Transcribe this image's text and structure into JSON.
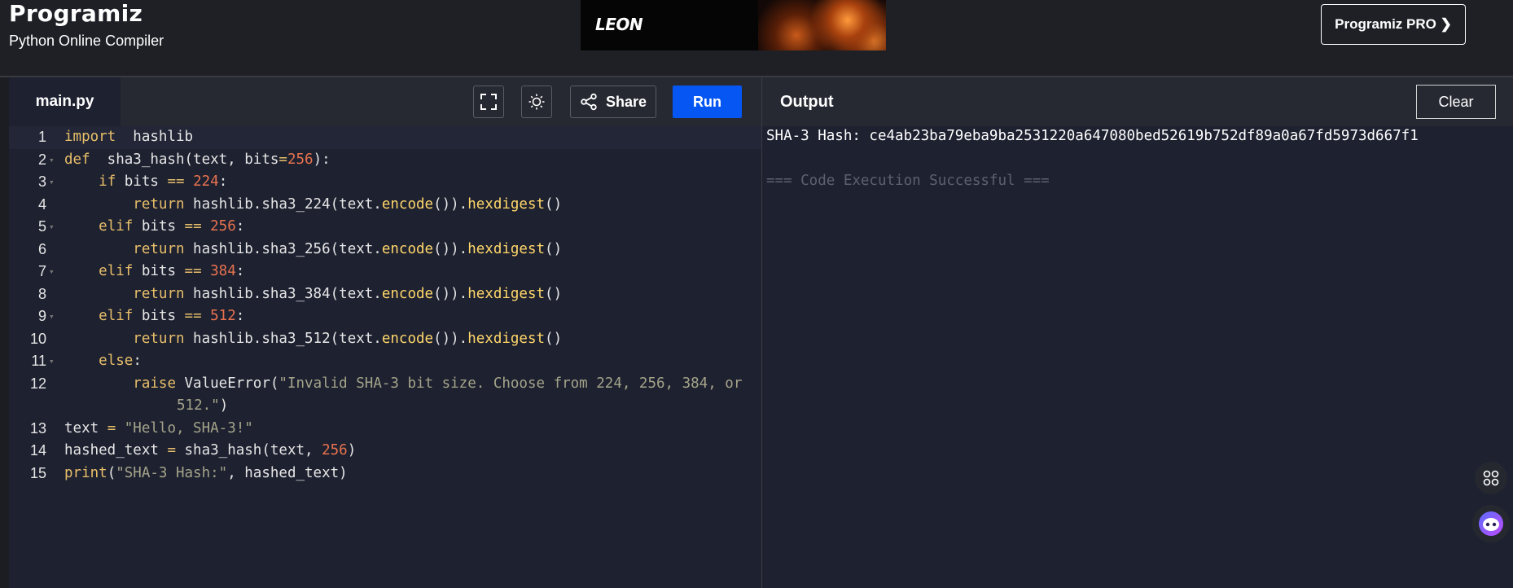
{
  "header": {
    "brand": "Programiz",
    "subtitle": "Python Online Compiler",
    "ad_text": "LEON",
    "pro_button": "Programiz PRO ❯"
  },
  "editor": {
    "file_tab": "main.py",
    "share_label": "Share",
    "run_label": "Run",
    "lines": [
      {
        "n": "1",
        "fold": false
      },
      {
        "n": "2",
        "fold": true
      },
      {
        "n": "3",
        "fold": true
      },
      {
        "n": "4",
        "fold": false
      },
      {
        "n": "5",
        "fold": true
      },
      {
        "n": "6",
        "fold": false
      },
      {
        "n": "7",
        "fold": true
      },
      {
        "n": "8",
        "fold": false
      },
      {
        "n": "9",
        "fold": true
      },
      {
        "n": "10",
        "fold": false
      },
      {
        "n": "11",
        "fold": true
      },
      {
        "n": "12",
        "fold": false
      },
      {
        "n": "13",
        "fold": false
      },
      {
        "n": "14",
        "fold": false
      },
      {
        "n": "15",
        "fold": false
      }
    ],
    "code": [
      [
        [
          "kw",
          "import"
        ],
        [
          "",
          "  hashlib"
        ]
      ],
      [
        [
          "kw",
          "def"
        ],
        [
          "",
          "  sha3_hash(text, bits"
        ],
        [
          "op",
          "="
        ],
        [
          "nm",
          "256"
        ],
        [
          "",
          "):"
        ]
      ],
      [
        [
          "",
          "    "
        ],
        [
          "kw",
          "if"
        ],
        [
          "",
          " bits "
        ],
        [
          "op",
          "=="
        ],
        [
          "",
          ""
        ],
        [
          "nm",
          " 224"
        ],
        [
          "",
          ":"
        ]
      ],
      [
        [
          "",
          "        "
        ],
        [
          "kw",
          "return"
        ],
        [
          "",
          " hashlib.sha3_224(text."
        ],
        [
          "fn",
          "encode"
        ],
        [
          "",
          "())."
        ],
        [
          "fn",
          "hexdigest"
        ],
        [
          "",
          "()"
        ]
      ],
      [
        [
          "",
          "    "
        ],
        [
          "kw",
          "elif"
        ],
        [
          "",
          " bits "
        ],
        [
          "op",
          "=="
        ],
        [
          "nm",
          " 256"
        ],
        [
          "",
          ":"
        ]
      ],
      [
        [
          "",
          "        "
        ],
        [
          "kw",
          "return"
        ],
        [
          "",
          " hashlib.sha3_256(text."
        ],
        [
          "fn",
          "encode"
        ],
        [
          "",
          "())."
        ],
        [
          "fn",
          "hexdigest"
        ],
        [
          "",
          "()"
        ]
      ],
      [
        [
          "",
          "    "
        ],
        [
          "kw",
          "elif"
        ],
        [
          "",
          " bits "
        ],
        [
          "op",
          "=="
        ],
        [
          "nm",
          " 384"
        ],
        [
          "",
          ":"
        ]
      ],
      [
        [
          "",
          "        "
        ],
        [
          "kw",
          "return"
        ],
        [
          "",
          " hashlib.sha3_384(text."
        ],
        [
          "fn",
          "encode"
        ],
        [
          "",
          "())."
        ],
        [
          "fn",
          "hexdigest"
        ],
        [
          "",
          "()"
        ]
      ],
      [
        [
          "",
          "    "
        ],
        [
          "kw",
          "elif"
        ],
        [
          "",
          " bits "
        ],
        [
          "op",
          "=="
        ],
        [
          "nm",
          " 512"
        ],
        [
          "",
          ":"
        ]
      ],
      [
        [
          "",
          "        "
        ],
        [
          "kw",
          "return"
        ],
        [
          "",
          " hashlib.sha3_512(text."
        ],
        [
          "fn",
          "encode"
        ],
        [
          "",
          "())."
        ],
        [
          "fn",
          "hexdigest"
        ],
        [
          "",
          "()"
        ]
      ],
      [
        [
          "",
          "    "
        ],
        [
          "kw",
          "else"
        ],
        [
          "",
          ":"
        ]
      ],
      [
        [
          "",
          "        "
        ],
        [
          "kw",
          "raise"
        ],
        [
          "",
          " ValueError("
        ],
        [
          "st",
          "\"Invalid SHA-3 bit size. Choose from 224, 256, 384, or"
        ]
      ],
      [
        [
          "",
          "text "
        ],
        [
          "op",
          "="
        ],
        [
          "st",
          " \"Hello, SHA-3!\""
        ]
      ],
      [
        [
          "",
          "hashed_text "
        ],
        [
          "op",
          "="
        ],
        [
          "",
          " sha3_hash(text, "
        ],
        [
          "nm",
          "256"
        ],
        [
          "",
          ")"
        ]
      ],
      [
        [
          "kw",
          "print"
        ],
        [
          "",
          "("
        ],
        [
          "st",
          "\"SHA-3 Hash:\""
        ],
        [
          "",
          ", hashed_text)"
        ]
      ]
    ],
    "wrap_line_12": [
      [
        "st",
        "512.\""
      ],
      [
        "",
        ")"
      ]
    ]
  },
  "output": {
    "title": "Output",
    "clear_label": "Clear",
    "result": "SHA-3 Hash: ce4ab23ba79eba9ba2531220a647080bed52619b752df89a0a67fd5973d667f1",
    "status": "=== Code Execution Successful ==="
  }
}
